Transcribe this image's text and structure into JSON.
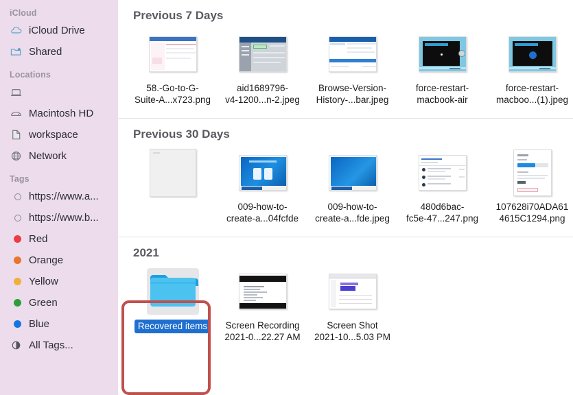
{
  "sidebar": {
    "sections": [
      {
        "title": "iCloud",
        "items": [
          {
            "label": "iCloud Drive",
            "icon": "cloud-icon"
          },
          {
            "label": "Shared",
            "icon": "shared-folder-icon"
          }
        ]
      },
      {
        "title": "Locations",
        "items": [
          {
            "label": "",
            "icon": "laptop-icon"
          },
          {
            "label": "Macintosh HD",
            "icon": "hard-drive-icon"
          },
          {
            "label": "workspace",
            "icon": "document-icon"
          },
          {
            "label": "Network",
            "icon": "globe-icon"
          }
        ]
      },
      {
        "title": "Tags",
        "items": [
          {
            "label": "https://www.a...",
            "icon": "tag-hollow-icon",
            "color": ""
          },
          {
            "label": "https://www.b...",
            "icon": "tag-hollow-icon",
            "color": ""
          },
          {
            "label": "Red",
            "icon": "tag-dot-icon",
            "color": "#ec3b43"
          },
          {
            "label": "Orange",
            "icon": "tag-dot-icon",
            "color": "#e8762c"
          },
          {
            "label": "Yellow",
            "icon": "tag-dot-icon",
            "color": "#efb13a"
          },
          {
            "label": "Green",
            "icon": "tag-dot-icon",
            "color": "#2aa039"
          },
          {
            "label": "Blue",
            "icon": "tag-dot-icon",
            "color": "#1277e0"
          },
          {
            "label": "All Tags...",
            "icon": "all-tags-icon",
            "color": ""
          }
        ]
      }
    ]
  },
  "content": {
    "groups": [
      {
        "title": "Previous 7 Days",
        "items": [
          {
            "name_lines": [
              "58.-Go-to-G-",
              "Suite-A...x723.png"
            ],
            "thumb": "screenshot-light-form",
            "selected": false
          },
          {
            "name_lines": [
              "aid1689796-",
              "v4-1200...n-2.jpeg"
            ],
            "thumb": "screenshot-blue-settings",
            "selected": false
          },
          {
            "name_lines": [
              "Browse-Version-",
              "History-...bar.jpeg"
            ],
            "thumb": "screenshot-blue-window",
            "selected": false
          },
          {
            "name_lines": [
              "force-restart-",
              "macbook-air"
            ],
            "thumb": "screenshot-dark-article",
            "selected": false
          },
          {
            "name_lines": [
              "force-restart-",
              "macboo...(1).jpeg"
            ],
            "thumb": "screenshot-dark-article-2",
            "selected": false
          }
        ]
      },
      {
        "title": "Previous 30 Days",
        "items": [
          {
            "name_lines": [],
            "thumb": "blank-page",
            "selected": false
          },
          {
            "name_lines": [
              "009-how-to-",
              "create-a...04fcfde"
            ],
            "thumb": "screenshot-blue-desktop",
            "selected": false
          },
          {
            "name_lines": [
              "009-how-to-",
              "create-a...fde.jpeg"
            ],
            "thumb": "screenshot-blue-desktop-2",
            "selected": false
          },
          {
            "name_lines": [
              "480d6bac-",
              "fc5e-47...247.png"
            ],
            "thumb": "screenshot-list-rows",
            "selected": false
          },
          {
            "name_lines": [
              "107628i70ADA61",
              "4615C1294.png"
            ],
            "thumb": "screenshot-storage-panel",
            "selected": false
          }
        ]
      },
      {
        "title": "2021",
        "items": [
          {
            "name_lines": [
              "Recovered items"
            ],
            "thumb": "folder-icon",
            "selected": true
          },
          {
            "name_lines": [
              "Screen Recording",
              "2021-0...22.27 AM"
            ],
            "thumb": "screenshot-code-dark-bars",
            "selected": false
          },
          {
            "name_lines": [
              "Screen Shot",
              "2021-10...5.03 PM"
            ],
            "thumb": "screenshot-chart-window",
            "selected": false
          }
        ]
      }
    ]
  },
  "colors": {
    "sidebar_bg": "#ecdcec",
    "selection_blue": "#1f6fd0",
    "annotation_red": "#c0504d",
    "group_title": "#5a5a61"
  }
}
